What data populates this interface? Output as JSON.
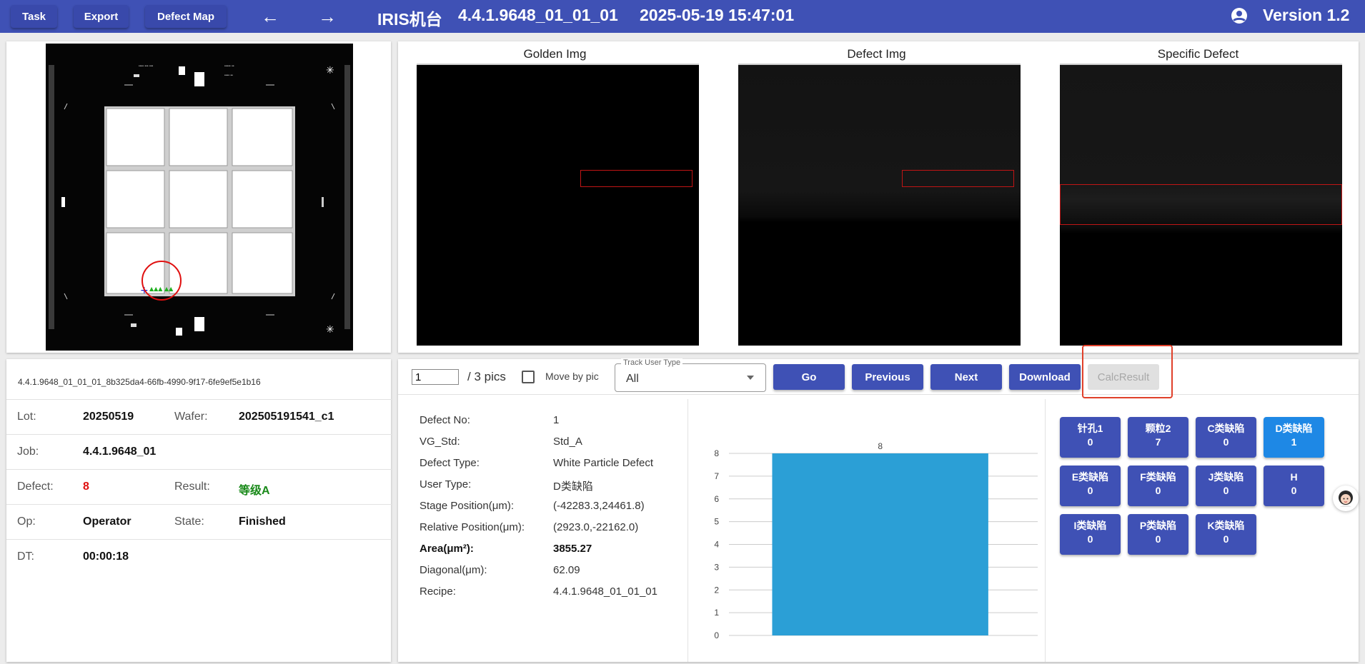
{
  "header": {
    "task_label": "Task",
    "export_label": "Export",
    "defect_map_label": "Defect Map",
    "back_icon": "arrow-left-icon",
    "forward_icon": "arrow-right-icon",
    "machine": "IRIS机台",
    "job_id": "4.4.1.9648_01_01_01",
    "datetime": "2025-05-19 15:47:01",
    "version": "Version 1.2",
    "bg_color": "#3f51b5"
  },
  "images": {
    "golden_label": "Golden Img",
    "defect_label": "Defect Img",
    "specific_label": "Specific Defect"
  },
  "info": {
    "wafer_id": "4.4.1.9648_01_01_01_8b325da4-66fb-4990-9f17-6fe9ef5e1b16",
    "lot_label": "Lot:",
    "lot": "20250519",
    "wafer_label": "Wafer:",
    "wafer": "202505191541_c1",
    "job_label": "Job:",
    "job": "4.4.1.9648_01",
    "defect_label": "Defect:",
    "defect": "8",
    "result_label": "Result:",
    "result": "等级A",
    "op_label": "Op:",
    "op": "Operator",
    "state_label": "State:",
    "state": "Finished",
    "dt_label": "DT:",
    "dt": "00:00:18"
  },
  "toolbar": {
    "page_value": "1",
    "page_total": "/ 3 pics",
    "move_by_pic_label": "Move by pic",
    "track_user_type_label": "Track User Type",
    "track_user_type_value": "All",
    "go_label": "Go",
    "previous_label": "Previous",
    "next_label": "Next",
    "download_label": "Download",
    "calc_result_label": "CalcResult"
  },
  "details": [
    {
      "label": "Defect No:",
      "value": "1"
    },
    {
      "label": "VG_Std:",
      "value": "Std_A"
    },
    {
      "label": "Defect Type:",
      "value": "White Particle Defect"
    },
    {
      "label": "User Type:",
      "value": "D类缺陷"
    },
    {
      "label": "Stage Position(μm):",
      "value": "(-42283.3,24461.8)"
    },
    {
      "label": "Relative Position(μm):",
      "value": "(2923.0,-22162.0)"
    },
    {
      "label": "Area(μm²):",
      "value": "3855.27"
    },
    {
      "label": "Diagonal(μm):",
      "value": "62.09"
    },
    {
      "label": "Recipe:",
      "value": "4.4.1.9648_01_01_01"
    }
  ],
  "chart_data": {
    "type": "bar",
    "categories": [
      ""
    ],
    "values": [
      8
    ],
    "ylim": [
      0,
      8
    ],
    "yticks": [
      "0",
      "1",
      "2",
      "3",
      "4",
      "5",
      "6",
      "7",
      "8"
    ],
    "data_label": "8",
    "bar_color": "#2b9fd6",
    "grid": true
  },
  "defect_buttons": [
    {
      "name": "针孔1",
      "count": "0"
    },
    {
      "name": "颗粒2",
      "count": "7"
    },
    {
      "name": "C类缺陷",
      "count": "0"
    },
    {
      "name": "D类缺陷",
      "count": "1",
      "active": true
    },
    {
      "name": "E类缺陷",
      "count": "0"
    },
    {
      "name": "F类缺陷",
      "count": "0"
    },
    {
      "name": "J类缺陷",
      "count": "0"
    },
    {
      "name": "H",
      "count": "0"
    },
    {
      "name": "I类缺陷",
      "count": "0"
    },
    {
      "name": "P类缺陷",
      "count": "0"
    },
    {
      "name": "K类缺陷",
      "count": "0"
    }
  ]
}
